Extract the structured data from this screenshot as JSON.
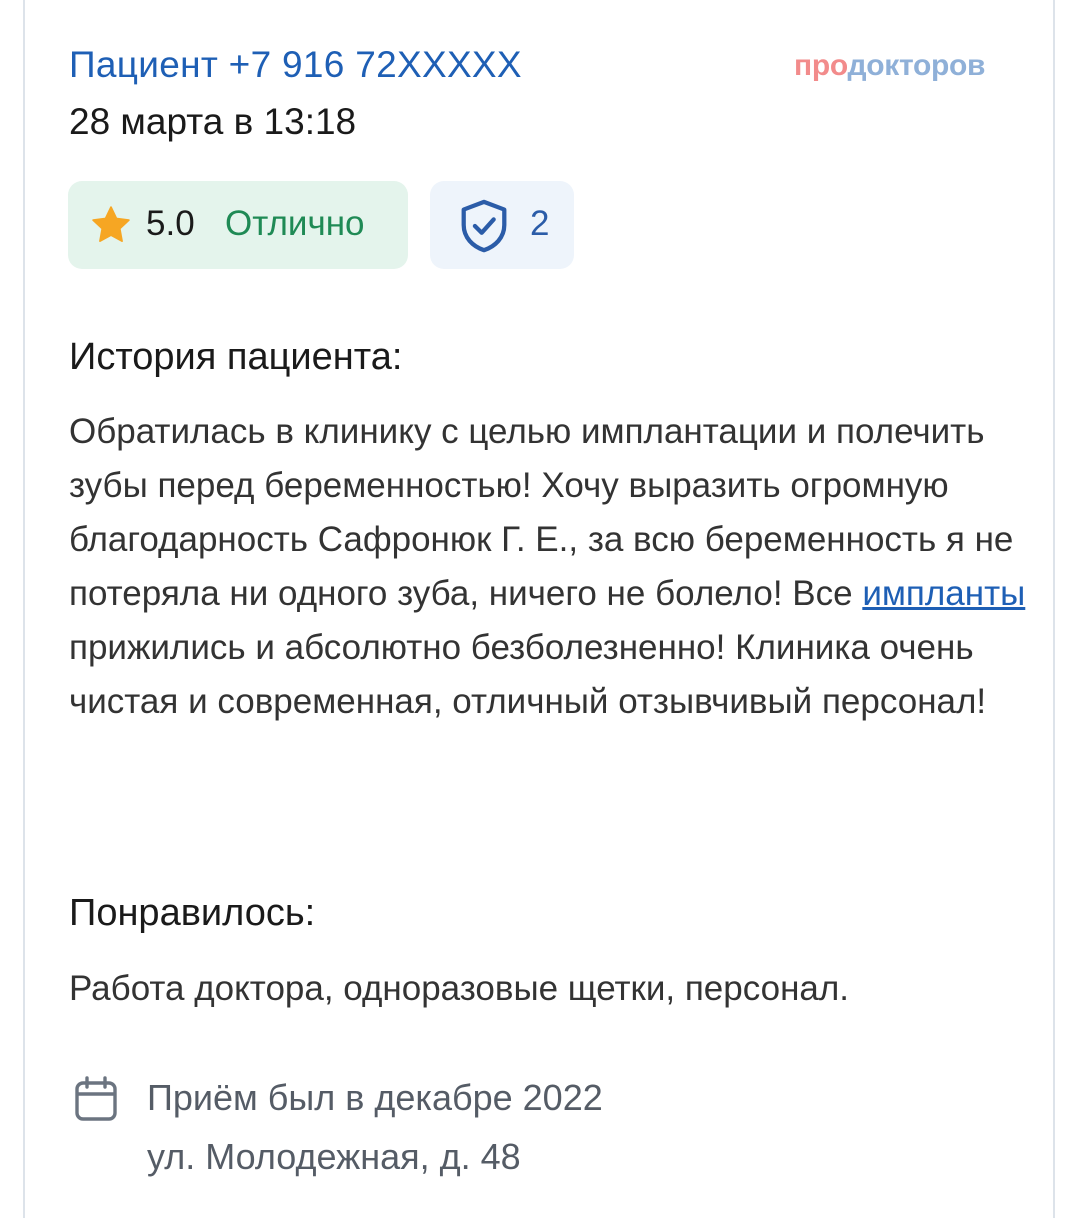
{
  "review": {
    "author": "Пациент +7 916 72XXXXX",
    "date": "28 марта в 13:18",
    "logo_pro": "про",
    "logo_doc": "докторов",
    "rating": {
      "value": "5.0",
      "word": "Отлично",
      "score": 5.0
    },
    "verified_count": "2",
    "story_heading": "История пациента:",
    "story_part1": "Обратилась в клинику с целью имплантации и полечить зубы перед беременностью! Хочу выразить огромную благодарность Сафронюк Г. Е., за всю беременность я не потеряла ни одного зуба, ничего не болело! Все ",
    "story_link": "импланты",
    "story_part2": " прижились и абсолютно безболезненно! Клиника очень чистая и современная, отличный отзывчивый персонал!",
    "liked_heading": "Понравилось:",
    "liked_text": "Работа доктора, одноразовые щетки, персонал.",
    "visit_text": "Приём был в декабре 2022",
    "address": "ул. Молодежная, д. 48"
  },
  "icons": {
    "rating": "star-icon",
    "verified": "shield-check-icon",
    "visit": "calendar-icon"
  },
  "colors": {
    "author_link": "#1e5fb5",
    "rating_bg": "#e4f4ec",
    "rating_word": "#1f8a55",
    "star": "#f6a623",
    "verify_bg": "#eef4fb",
    "shield": "#2b5ca8",
    "logo_pro": "#f28b8b",
    "logo_doc": "#8fb0d8"
  }
}
